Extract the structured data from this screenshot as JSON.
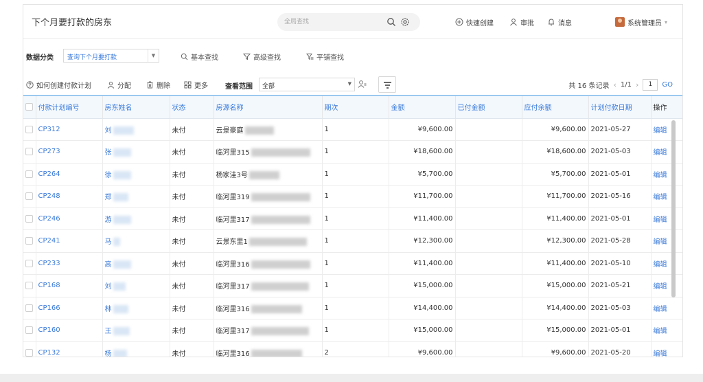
{
  "header": {
    "title": "下个月要打款的房东",
    "search_placeholder": "全局查找",
    "quick_create": "快速创建",
    "approve": "审批",
    "messages": "消息",
    "user": "系统管理员"
  },
  "filter_bar": {
    "label": "数据分类",
    "category_value": "查询下个月要打款",
    "basic_search": "基本查找",
    "advanced_search": "高级查找",
    "tiled_search": "平铺查找"
  },
  "toolbar": {
    "how_to": "如何创建付款计划",
    "assign": "分配",
    "delete": "删除",
    "more": "更多",
    "scope_label": "查看范围",
    "scope_value": "全部",
    "record_count": "共 16 条记录",
    "page_info": "1/1",
    "page_input": "1",
    "go": "GO"
  },
  "table": {
    "columns": [
      "付款计划编号",
      "房东姓名",
      "状态",
      "房源名称",
      "期次",
      "金额",
      "已付金额",
      "应付余额",
      "计划付款日期",
      "操作"
    ],
    "rows": [
      {
        "code": "CP312",
        "name": "刘",
        "status": "未付",
        "house": "云景豪庭",
        "period": "1",
        "amount": "¥9,600.00",
        "paid": "",
        "balance": "¥9,600.00",
        "date": "2021-05-27",
        "op": "编辑"
      },
      {
        "code": "CP273",
        "name": "张",
        "status": "未付",
        "house": "临河里315",
        "period": "1",
        "amount": "¥18,600.00",
        "paid": "",
        "balance": "¥18,600.00",
        "date": "2021-05-03",
        "op": "编辑"
      },
      {
        "code": "CP264",
        "name": "徐",
        "status": "未付",
        "house": "杨家洼3号",
        "period": "1",
        "amount": "¥5,700.00",
        "paid": "",
        "balance": "¥5,700.00",
        "date": "2021-05-01",
        "op": "编辑"
      },
      {
        "code": "CP248",
        "name": "郑",
        "status": "未付",
        "house": "临河里319",
        "period": "1",
        "amount": "¥11,700.00",
        "paid": "",
        "balance": "¥11,700.00",
        "date": "2021-05-16",
        "op": "编辑"
      },
      {
        "code": "CP246",
        "name": "游",
        "status": "未付",
        "house": "临河里317",
        "period": "1",
        "amount": "¥11,400.00",
        "paid": "",
        "balance": "¥11,400.00",
        "date": "2021-05-01",
        "op": "编辑"
      },
      {
        "code": "CP241",
        "name": "马",
        "status": "未付",
        "house": "云景东里1",
        "period": "1",
        "amount": "¥12,300.00",
        "paid": "",
        "balance": "¥12,300.00",
        "date": "2021-05-28",
        "op": "编辑"
      },
      {
        "code": "CP233",
        "name": "高",
        "status": "未付",
        "house": "临河里316",
        "period": "1",
        "amount": "¥11,400.00",
        "paid": "",
        "balance": "¥11,400.00",
        "date": "2021-05-10",
        "op": "编辑"
      },
      {
        "code": "CP168",
        "name": "刘",
        "status": "未付",
        "house": "临河里317",
        "period": "1",
        "amount": "¥15,000.00",
        "paid": "",
        "balance": "¥15,000.00",
        "date": "2021-05-21",
        "op": "编辑"
      },
      {
        "code": "CP166",
        "name": "林",
        "status": "未付",
        "house": "临河里316",
        "period": "1",
        "amount": "¥14,400.00",
        "paid": "",
        "balance": "¥14,400.00",
        "date": "2021-05-03",
        "op": "编辑"
      },
      {
        "code": "CP160",
        "name": "王",
        "status": "未付",
        "house": "临河里317",
        "period": "1",
        "amount": "¥15,000.00",
        "paid": "",
        "balance": "¥15,000.00",
        "date": "2021-05-01",
        "op": "编辑"
      },
      {
        "code": "CP132",
        "name": "杨",
        "status": "未付",
        "house": "临河里316",
        "period": "2",
        "amount": "¥9,600.00",
        "paid": "",
        "balance": "¥9,600.00",
        "date": "2021-05-20",
        "op": "编辑"
      }
    ]
  },
  "colors": {
    "accent": "#3a7ad9",
    "header_bg": "#f3f8fd"
  }
}
